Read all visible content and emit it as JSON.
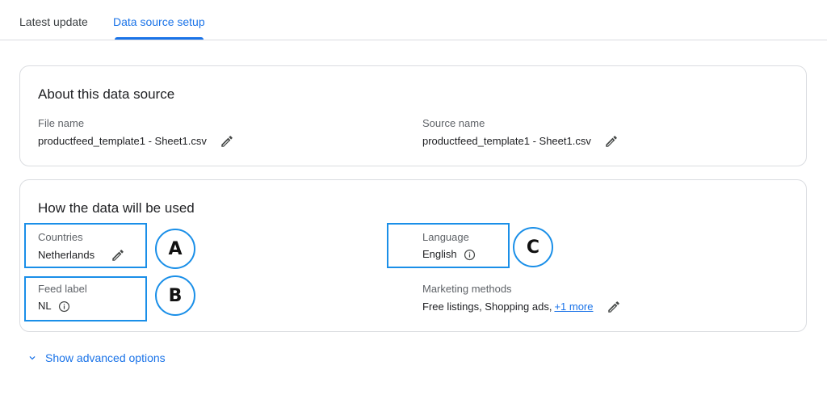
{
  "tabs": [
    {
      "label": "Latest update",
      "active": false
    },
    {
      "label": "Data source setup",
      "active": true
    }
  ],
  "about": {
    "title": "About this data source",
    "file_name": {
      "label": "File name",
      "value": "productfeed_template1 - Sheet1.csv",
      "icon": "pencil-icon"
    },
    "source_name": {
      "label": "Source name",
      "value": "productfeed_template1 - Sheet1.csv",
      "icon": "pencil-icon"
    }
  },
  "usage": {
    "title": "How the data will be used",
    "countries": {
      "label": "Countries",
      "value": "Netherlands",
      "icon": "pencil-icon"
    },
    "feed_label": {
      "label": "Feed label",
      "value": "NL",
      "icon": "info-icon"
    },
    "language": {
      "label": "Language",
      "value": "English",
      "icon": "info-icon"
    },
    "marketing": {
      "label": "Marketing methods",
      "value": "Free listings, Shopping ads,",
      "more_link": "+1 more",
      "icon": "pencil-icon"
    }
  },
  "callouts": {
    "a": "A",
    "b": "B",
    "c": "C"
  },
  "advanced_options": {
    "label": "Show advanced options",
    "icon": "chevron-down-icon"
  },
  "colors": {
    "accent": "#1a73e8",
    "callout": "#1a8fe8",
    "border": "#dadce0"
  }
}
